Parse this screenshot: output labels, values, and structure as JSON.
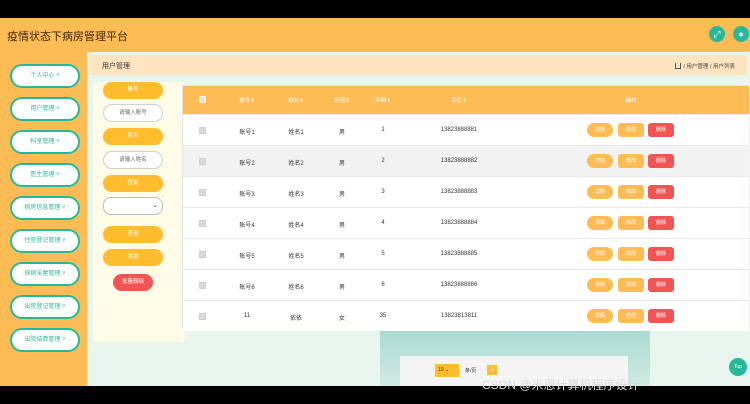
{
  "header": {
    "title": "疫情状态下病房管理平台"
  },
  "sidebar": {
    "items": [
      "个人中心 ˅",
      "用户管理 ˅",
      "科室管理 ˅",
      "医生管理 ˅",
      "病房信息管理 ˅",
      "住院登记管理 ˅",
      "探病采屋管理 ˅",
      "出院登记管理 ˅",
      "出院结算管理 ˅"
    ]
  },
  "page": {
    "title": "用户管理",
    "breadcrumb": "/ 用户管理 / 用户列表"
  },
  "filters": {
    "account_label": "账号",
    "account_placeholder": "请输入账号",
    "name_label": "姓名",
    "name_placeholder": "请输入姓名",
    "gender_label": "性别",
    "search_button": "查询",
    "add_button": "添加",
    "batch_delete_button": "批量删除"
  },
  "table": {
    "headers": [
      "账号⇕",
      "姓名⇕",
      "性别⇕",
      "年龄⇕",
      "手机⇕",
      "操作"
    ],
    "actions": {
      "view": "详情",
      "edit": "修改",
      "delete": "删除"
    },
    "rows": [
      {
        "account": "账号1",
        "name": "姓名1",
        "gender": "男",
        "age": "1",
        "phone": "13823888881"
      },
      {
        "account": "账号2",
        "name": "姓名2",
        "gender": "男",
        "age": "2",
        "phone": "13823888882"
      },
      {
        "account": "账号3",
        "name": "姓名3",
        "gender": "男",
        "age": "3",
        "phone": "13823888883"
      },
      {
        "account": "账号4",
        "name": "姓名4",
        "gender": "男",
        "age": "4",
        "phone": "13823888884"
      },
      {
        "account": "账号5",
        "name": "姓名5",
        "gender": "男",
        "age": "5",
        "phone": "13823888885"
      },
      {
        "account": "账号6",
        "name": "姓名6",
        "gender": "男",
        "age": "6",
        "phone": "13823888886"
      },
      {
        "account": "11",
        "name": "依依",
        "gender": "女",
        "age": "35",
        "phone": "13823813811"
      }
    ]
  },
  "pagination": {
    "page_size": "10",
    "page_size_label": "条/页",
    "current_page": "1"
  },
  "top_button": "Top",
  "watermark": "CSDN @米恩计算机程序设计",
  "colors": {
    "primary": "#ffbc55",
    "accent": "#25b99a",
    "danger": "#f25454"
  },
  "icons": {
    "header": [
      "expand-icon",
      "user-icon"
    ]
  }
}
